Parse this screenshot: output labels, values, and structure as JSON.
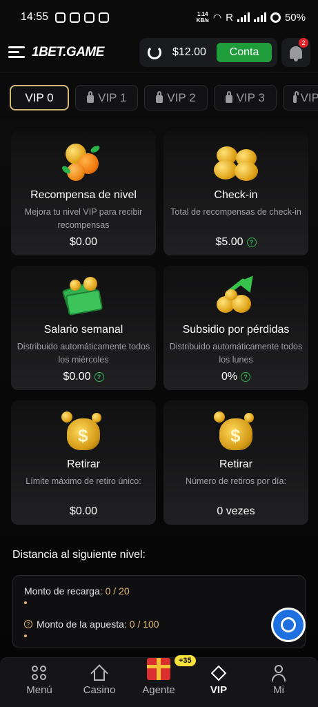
{
  "status_bar": {
    "time": "14:55",
    "speed": "1.14\nKB/s",
    "signal_label": "R",
    "battery": "50%"
  },
  "header": {
    "logo": "1BET.GAME",
    "balance": "$12.00",
    "contact_label": "Conta",
    "notification_count": "2"
  },
  "vip_tabs": [
    {
      "label": "VIP 0",
      "locked": false
    },
    {
      "label": "VIP 1",
      "locked": true
    },
    {
      "label": "VIP 2",
      "locked": true
    },
    {
      "label": "VIP 3",
      "locked": true
    },
    {
      "label": "VIP 4",
      "locked": true
    }
  ],
  "cards": [
    {
      "title": "Recompensa de nivel",
      "desc": "Mejora tu nivel VIP para recibir recompensas",
      "value": "$0.00",
      "help": false,
      "icon": "fruit-coins-icon"
    },
    {
      "title": "Check-in",
      "desc": "Total de recompensas de check-in",
      "value": "$5.00",
      "help": true,
      "icon": "coin-stack-icon"
    },
    {
      "title": "Salario semanal",
      "desc": "Distribuido automáticamente todos los miércoles",
      "value": "$0.00",
      "help": true,
      "icon": "money-bills-icon"
    },
    {
      "title": "Subsidio por pérdidas",
      "desc": "Distribuido automáticamente todos los lunes",
      "value": "0%",
      "help": true,
      "icon": "coins-arrow-icon"
    },
    {
      "title": "Retirar",
      "desc": "Límite máximo de retiro único:",
      "value": "$0.00",
      "help": false,
      "icon": "money-bag-icon"
    },
    {
      "title": "Retirar",
      "desc": "Número de retiros por día:",
      "value": "0 vezes",
      "help": false,
      "icon": "money-bag-icon"
    }
  ],
  "progress": {
    "heading": "Distancia al siguiente nivel:",
    "recharge_label": "Monto de recarga:",
    "recharge_amount": "0 / 20",
    "recharge_fraction": 0,
    "bet_label": "Monto de la apuesta:",
    "bet_amount": "0 / 100",
    "bet_fraction": 0
  },
  "agent_badge": "+35",
  "bottom_nav": [
    {
      "label": "Menú",
      "icon": "grid-icon",
      "active": false
    },
    {
      "label": "Casino",
      "icon": "home-icon",
      "active": false
    },
    {
      "label": "Agente",
      "icon": "gift-icon",
      "active": false
    },
    {
      "label": "VIP",
      "icon": "diamond-icon",
      "active": true
    },
    {
      "label": "Mi",
      "icon": "user-icon",
      "active": false
    }
  ],
  "colors": {
    "accent_green": "#1f9d3a",
    "gold": "#e3b968",
    "support_blue": "#1e6fe0"
  }
}
